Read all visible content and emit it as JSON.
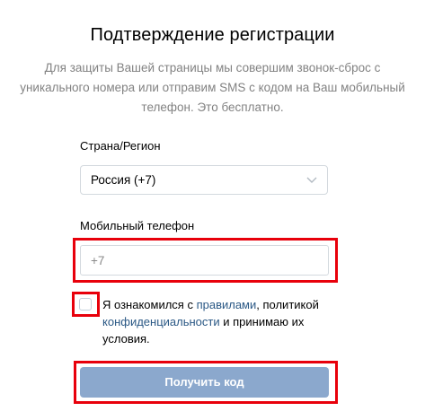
{
  "page": {
    "title": "Подтверждение регистрации",
    "description": "Для защиты Вашей страницы мы совершим звонок-сброс с уникального номера или отправим SMS с кодом на Ваш мобильный телефон. Это бесплатно."
  },
  "country": {
    "label": "Страна/Регион",
    "selected": "Россия (+7)"
  },
  "phone": {
    "label": "Мобильный телефон",
    "placeholder": "+7"
  },
  "consent": {
    "checked": false,
    "text_before": "Я ознакомился с ",
    "rules_link": "правилами",
    "text_middle": ", политикой ",
    "privacy_link": "конфиденциальности",
    "text_after": " и принимаю их условия."
  },
  "submit": {
    "label": "Получить код"
  },
  "colors": {
    "link": "#2a5885",
    "button_bg": "#8ba8cd",
    "highlight": "#e8000b"
  },
  "icons": {
    "select_arrow": "chevron-down-icon"
  }
}
